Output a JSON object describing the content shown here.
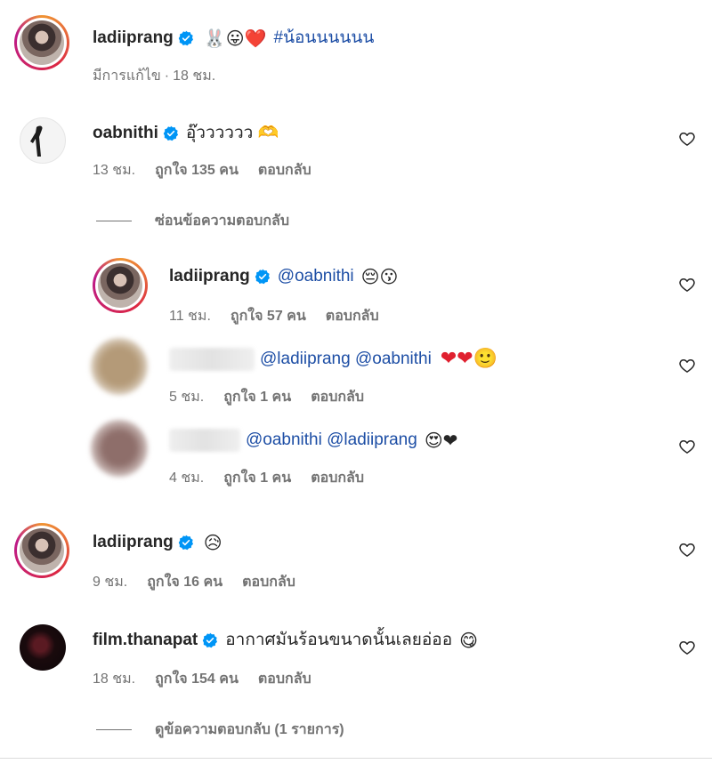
{
  "post": {
    "username": "ladiiprang",
    "caption_emojis": "🐰😛❤️",
    "hashtag": "#น้อนนนนนน",
    "edited": "มีการแก้ไข",
    "separator": "·",
    "time": "18 ชม."
  },
  "comments": [
    {
      "username": "oabnithi",
      "text": "อุ๊วววววว 🫶",
      "time": "13 ชม.",
      "likes": "ถูกใจ 135 คน",
      "reply": "ตอบกลับ",
      "toggle": "ซ่อนข้อความตอบกลับ",
      "replies": [
        {
          "username": "ladiiprang",
          "mention": "@oabnithi",
          "emojis": "😔😗",
          "time": "11 ชม.",
          "likes": "ถูกใจ 57 คน",
          "reply": "ตอบกลับ"
        },
        {
          "mention": "@ladiiprang @oabnithi",
          "emojis": "❤❤🙂",
          "time": "5 ชม.",
          "likes": "ถูกใจ 1 คน",
          "reply": "ตอบกลับ"
        },
        {
          "mention": "@oabnithi @ladiiprang",
          "emojis": "😍❤",
          "time": "4 ชม.",
          "likes": "ถูกใจ 1 คน",
          "reply": "ตอบกลับ"
        }
      ]
    },
    {
      "username": "ladiiprang",
      "emojis": "😥",
      "time": "9 ชม.",
      "likes": "ถูกใจ 16 คน",
      "reply": "ตอบกลับ"
    },
    {
      "username": "film.thanapat",
      "text": "อากาศมันร้อนขนาดนั้นเลยอ่ออ",
      "emojis": "😋",
      "time": "18 ชม.",
      "likes": "ถูกใจ 154 คน",
      "reply": "ตอบกลับ",
      "toggle": "ดูข้อความตอบกลับ (1 รายการ)"
    }
  ],
  "icons": {
    "verified": "verified-badge-icon",
    "like": "heart-outline-icon"
  },
  "colors": {
    "verified": "#0095f6",
    "mention": "#1d4ea5",
    "meta": "#737373"
  }
}
